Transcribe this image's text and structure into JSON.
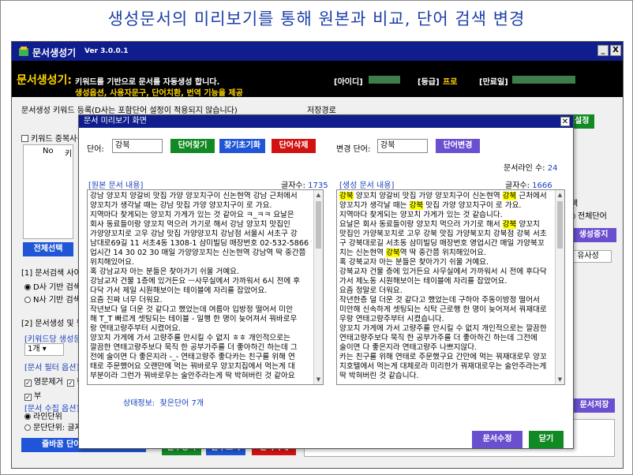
{
  "banner": "생성문서의 미리보기를 통해 원본과 비교, 단어 검색 변경",
  "window": {
    "app_name": "문서생성기",
    "version": "Ver 3.0.0.1",
    "min": "_",
    "close": "X"
  },
  "header": {
    "brand": "문서생성기:",
    "desc1": "키워드를 기반으로 문서를 자동생성 합니다.",
    "desc2": "생성옵션, 사용자문구, 단어치환, 번역 기능을 제공",
    "id_label": "[아이디]",
    "grade_label": "[등급]",
    "grade_value": "프로",
    "expiry_label": "[만료일]"
  },
  "background": {
    "kw_register": "문서생성 키워드 등록(D사는 포함단어 설정이 적용되지 않습니다)",
    "save_path": "저장경로",
    "path_setting": "경로설정",
    "dup_keyword": "키워드 중복사용",
    "col_no": "No",
    "col_kw": "키",
    "select_all": "전체선택",
    "search_site": "[1] 문서검색 사이트",
    "d_base": "D사 기반 검색",
    "n_base": "N사 기반 검색",
    "gen_filter": "[2] 문서생성 및 필터",
    "kw_gen_count": "[키워드당 생성문서]",
    "count_val": "1개",
    "doc_filter": "[문서 필터 옵션]",
    "eng_remove": "영문제거",
    "hanja": "한",
    "extra": "부",
    "collect_unit": "[문서 수집 옵션]",
    "line_unit": "라인단위",
    "para_unit": "문단단위:",
    "char_count": "글자수",
    "char_value": "200",
    "ja": "자",
    "word_view": "줄바꿈 단어 보기 및 설정",
    "full_word": "전체단어",
    "gen_stop": "생성중지",
    "similarity": "유사성",
    "doc_save": "문서저장",
    "phrase_reg": "문구등록",
    "phrase_view": "문구보기",
    "sel_delete": "선택삭제",
    "right_mark": "택"
  },
  "modal": {
    "title": "문서 미리보기 화면",
    "word_label": "단어:",
    "word_value": "강북",
    "find_word": "단어찾기",
    "find_reset": "찾기초기화",
    "word_delete": "단어삭제",
    "change_label": "변경 단어:",
    "change_value": "강북",
    "change_word": "단어변경",
    "doc_lines_label": "문서라인 수:",
    "doc_lines": "24",
    "orig_head": "[원본 문서 내용]",
    "orig_count_label": "글자수:",
    "orig_count": "1735",
    "gen_head": "[생성 문서 내용]",
    "gen_count_label": "글자수:",
    "gen_count": "1666",
    "status_label": "상태정보:",
    "status_value": "찾은단어 7개",
    "edit_doc": "문서수정",
    "close": "닫기",
    "orig_lines": [
      "강남 양꼬치 양갈비 맛집 가양 양꼬치구이 신논현역 강남 근처에서",
      "양꼬치가 생각날 때는 강남 맛집 가양 양꼬치구이 로 가요.",
      "지역마다 찾게되는 양꼬치 가게가 있는 것 같아요 ㅋ_ㅋㅋ 요날은",
      "회사 동료들이랑 양꼬치 먹으러 가기로 해서 강남 양꼬치 맛집인",
      "가양양꼬치로 고우 강남 맛집 가양양꼬치 강남점 서울시 서초구 강",
      "남대로69길 11 서초4동 1308-1 삼미빌딩 매장번호 02-532-5866 영",
      "업시간 14 30 02 30 매일 가양양꼬치는 신논현역 강남역 딱 중간쯤",
      "위치해있어요.",
      "혹 강남교자 아는 분들은 찾아가기 쉬울 거예요.",
      "강남교자 건물 1층에 있거든요 ㅡ사무실에서 가까워서 6시 전에 후",
      "다닥 가서 제일 시원해보이는 테이블에 자리를 잡았어요.",
      "요즘 진짜 너무 더워요.",
      "작년보다 덜 더운 것 같다고 했었는데 여름아 입방정 떨어서 미안",
      "해 T_T 빠르게 셋팅되는 테이블 - 일행 한 명이 늦어져서 꿔바로우",
      "랑 연태고량주부터 시켰어요.",
      "양꼬치 가게에 가서 고량주를 안시킬 수 없지 ㅎㅎ 개인적으로는",
      "깔끔한 연태고량주보다 묵직 한 공부가주를 더 좋아하긴 하는데 그",
      "전에 술이면 다 좋은지라 -_- 연태고량주 좋다카는 친구를 위해 연",
      "태로 주문했어요 오랜만에 먹는 꿔바로우 양꼬치집에서 먹는게 대",
      "부분이라 그런가 꿔바로우는 술안주라는게 딱 박혀버린 것 같아요"
    ],
    "gen_lines": [
      [
        "",
        "강북",
        " 양꼬치 양갈비 맛집 가양 양꼬치구이 신논현역 ",
        "강북",
        " 근처에서"
      ],
      [
        "양꼬치가 생각날 때는 ",
        "강북",
        " 맛집 가양 양꼬치구이 로 가요."
      ],
      [
        "지역마다 찾게되는 양꼬치 가게가 있는 것 같습니다."
      ],
      [
        "요날은 회사 동료들이랑 양꼬치 먹으러 가기로 해서 ",
        "강북",
        " 양꼬치"
      ],
      [
        "맛집인 가양북꼬치로 고우 강북 맛집 가양북꼬치 강북점 강북 서초"
      ],
      [
        "구 강북대로길 서초동 삼미빌딩 매장번호 영업시간 매일 가양북꼬"
      ],
      [
        "치는 신논현역 ",
        "강북",
        "역 딱 중간쯤 위치해있어요."
      ],
      [
        "혹 강북교자 아는 분들은 찾아가기 쉬울 거예요."
      ],
      [
        "강북교자 건물 층에 있거든요 사무실에서 가까워서 시 전에 후다닥"
      ],
      [
        "가서 제노동 시원해보이는 테이블에 자리를 잡았어요."
      ],
      [
        "요즘 정말로 더워요."
      ],
      [
        "작년한층 덜 더운 것 같다고 했었는데 구하아 주동이방정 떨어서"
      ],
      [
        "미안해 신속하게 셋팅되는 식탁 근로행 한 명이 늦어져서 꿔재대로"
      ],
      [
        "우랑 연태고량주부터 시켰습니다."
      ],
      [
        "양꼬치 가게에 가서 고량주를 안시킬 수 없지 개인적으로는 깔끔한"
      ],
      [
        "연태고량주보다 묵직 한 공부가주를 더 좋아하긴 하는데 그전에"
      ],
      [
        "술이면 다 좋은지라 연태고량주 나쁘지않다."
      ],
      [
        "카는 친구를 위해 연태로 주문했구요 간만에 먹는 꿔재대로우 양꼬"
      ],
      [
        "치호텔에서 먹는게 대체로라 미리한가 꿔재대로우는 술안주라는게"
      ],
      [
        "딱 박혀버린 것 같습니다."
      ]
    ]
  }
}
